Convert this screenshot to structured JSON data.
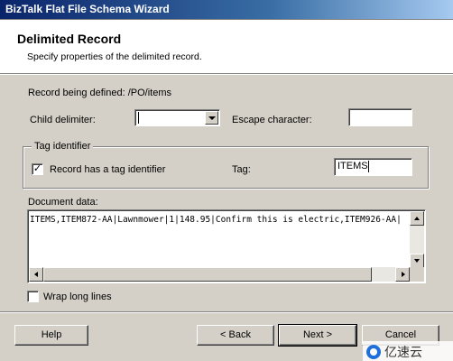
{
  "window": {
    "title": "BizTalk Flat File Schema Wizard"
  },
  "header": {
    "title": "Delimited Record",
    "subtitle": "Specify properties of the delimited record."
  },
  "record": {
    "label": "Record being defined:",
    "path": "/PO/items"
  },
  "child_delimiter": {
    "label": "Child delimiter:",
    "value": ""
  },
  "escape_character": {
    "label": "Escape character:",
    "value": ""
  },
  "tag_identifier": {
    "group_title": "Tag identifier",
    "checkbox_label": "Record has a tag identifier",
    "checked": true,
    "tag_label": "Tag:",
    "tag_value": "ITEMS"
  },
  "document_data": {
    "label": "Document data:",
    "line": "ITEMS,ITEM872-AA|Lawnmower|1|148.95|Confirm this is electric,ITEM926-AA|"
  },
  "wrap": {
    "label": "Wrap long lines",
    "checked": false
  },
  "buttons": {
    "help": "Help",
    "back": "< Back",
    "next": "Next >",
    "cancel": "Cancel"
  },
  "icons": {
    "checkbox_checked": "checkmark-icon",
    "dropdown": "chevron-down-icon"
  },
  "watermark": {
    "text": "亿速云"
  },
  "colors": {
    "titlebar_start": "#0a246a",
    "titlebar_end": "#a6caf0",
    "dialog_bg": "#d4d0c8",
    "header_bg": "#ffffff"
  }
}
